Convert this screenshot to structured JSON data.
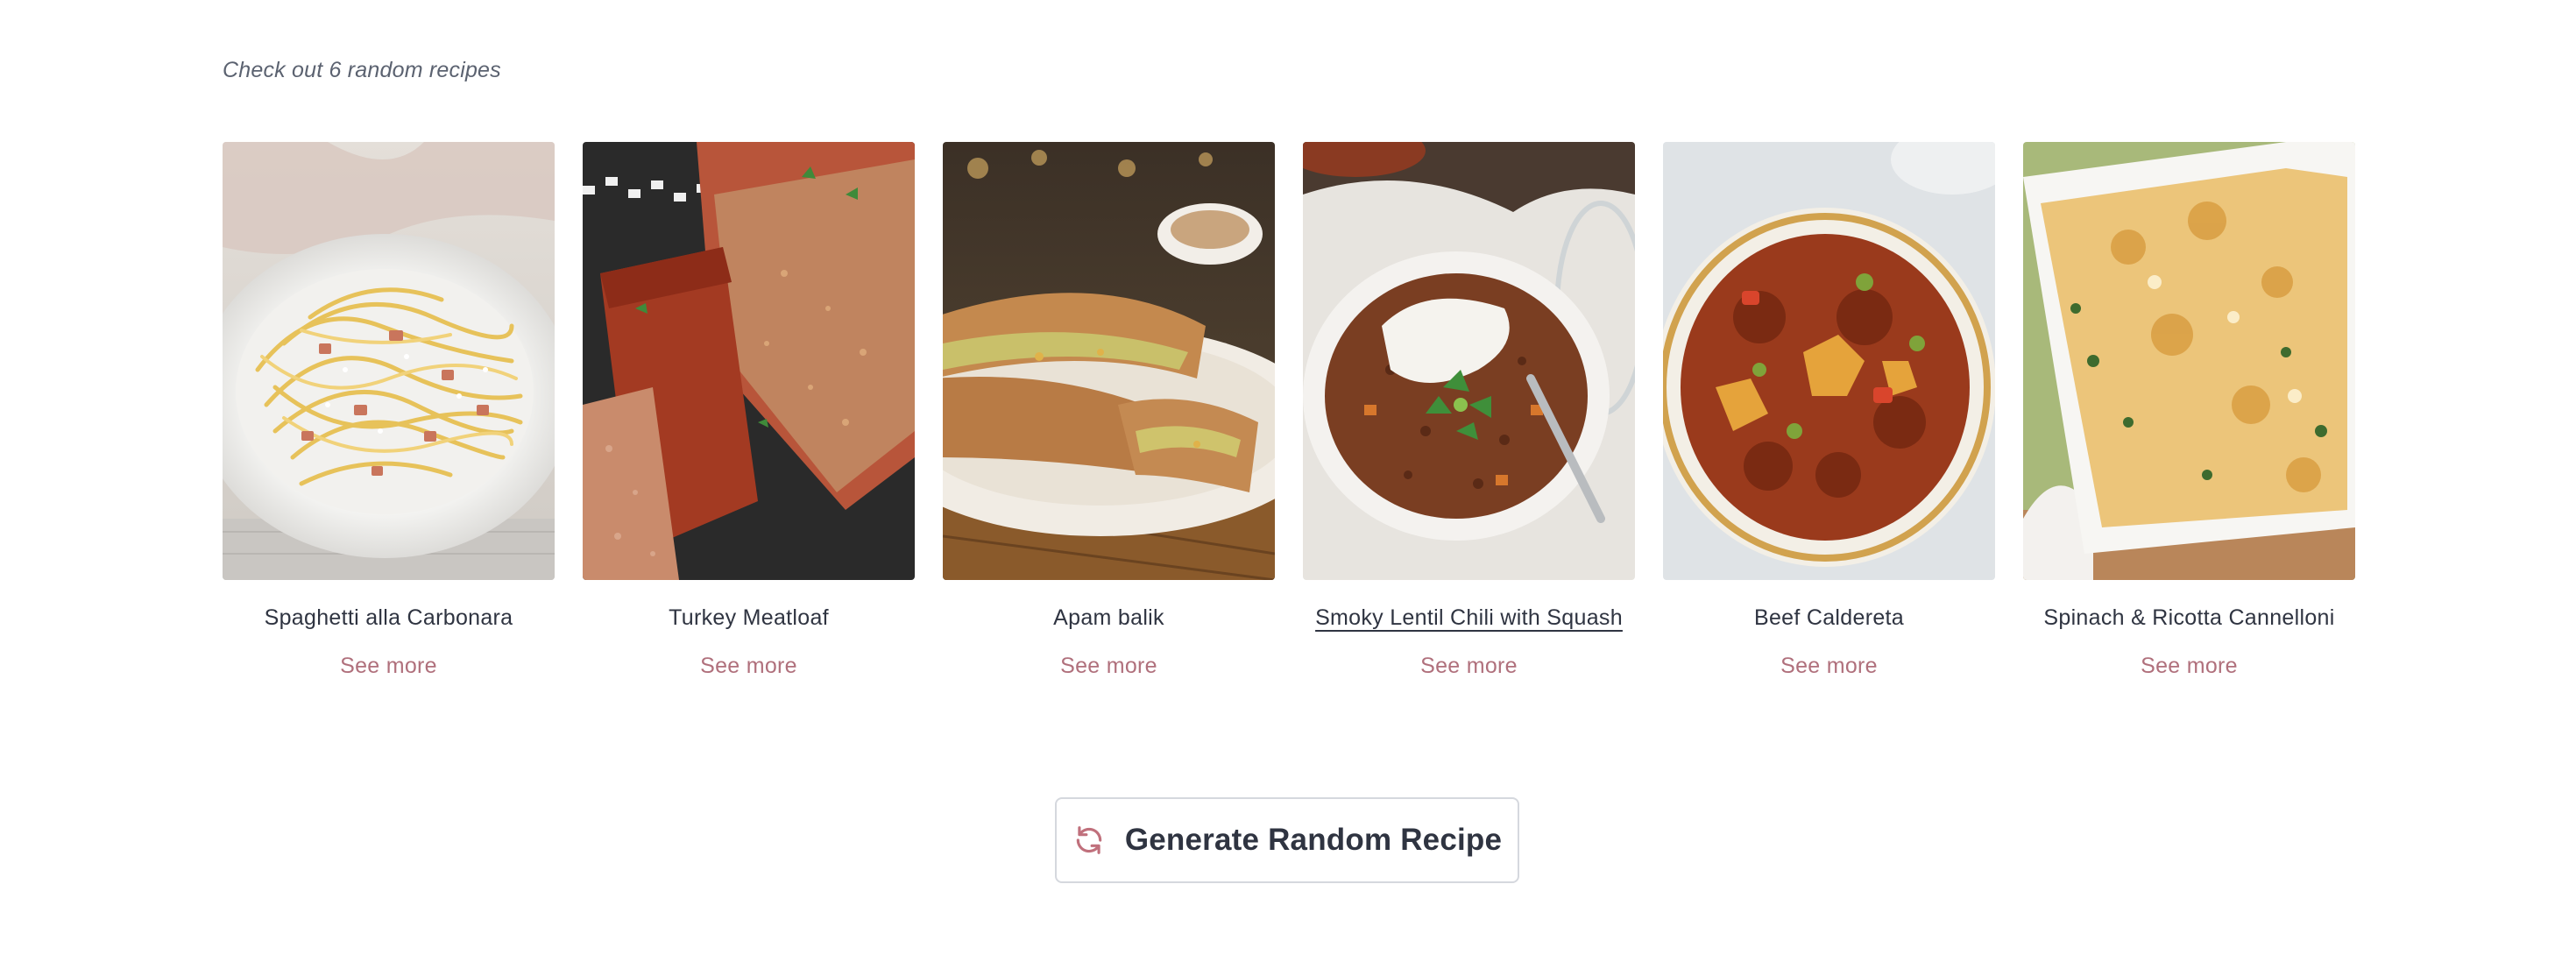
{
  "intro": "Check out 6 random recipes",
  "recipes": [
    {
      "title": "Spaghetti alla Carbonara",
      "link": "See more"
    },
    {
      "title": "Turkey Meatloaf",
      "link": "See more"
    },
    {
      "title": "Apam balik",
      "link": "See more"
    },
    {
      "title": "Smoky Lentil Chili with Squash",
      "link": "See more"
    },
    {
      "title": "Beef Caldereta",
      "link": "See more"
    },
    {
      "title": "Spinach & Ricotta Cannelloni",
      "link": "See more"
    }
  ],
  "action": {
    "label": "Generate Random Recipe",
    "icon": "refresh-icon"
  },
  "colors": {
    "link": "#b0707c",
    "text": "#2f3441",
    "muted": "#5b6270",
    "border": "#d5d8de"
  }
}
